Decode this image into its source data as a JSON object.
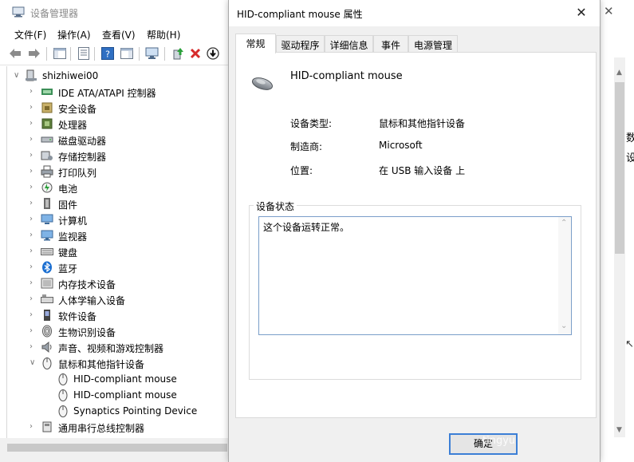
{
  "device_manager": {
    "title": "设备管理器",
    "menu": [
      "文件(F)",
      "操作(A)",
      "查看(V)",
      "帮助(H)"
    ],
    "root": "shizhiwei00",
    "categories": [
      "IDE ATA/ATAPI 控制器",
      "安全设备",
      "处理器",
      "磁盘驱动器",
      "存储控制器",
      "打印队列",
      "电池",
      "固件",
      "计算机",
      "监视器",
      "键盘",
      "蓝牙",
      "内存技术设备",
      "人体学输入设备",
      "软件设备",
      "生物识别设备",
      "声音、视频和游戏控制器",
      "鼠标和其他指针设备"
    ],
    "mouse_children": [
      "HID-compliant mouse",
      "HID-compliant mouse",
      "Synaptics Pointing Device"
    ],
    "after_mouse": [
      "通用串行总线控制器"
    ]
  },
  "dialog": {
    "title": "HID-compliant mouse 属性",
    "close_glyph": "✕",
    "tabs": [
      "常规",
      "驱动程序",
      "详细信息",
      "事件",
      "电源管理"
    ],
    "active_tab": "常规",
    "device_name": "HID-compliant mouse",
    "device_type_label": "设备类型:",
    "device_type_value": "鼠标和其他指针设备",
    "manufacturer_label": "制造商:",
    "manufacturer_value": "Microsoft",
    "location_label": "位置:",
    "location_value": "在 USB 输入设备 上",
    "status_group_label": "设备状态",
    "status_text": "这个设备运转正常。",
    "ok_label": "确定"
  },
  "right_strip": {
    "close_glyph": "✕",
    "text_1": "数",
    "text_2": "设"
  },
  "watermark": "tingyu",
  "colors": {
    "accent": "#3c7fd6",
    "status_border": "#7a9ec9",
    "bluetooth": "#1c6fd1",
    "uninstall_red": "#d62a2a"
  }
}
